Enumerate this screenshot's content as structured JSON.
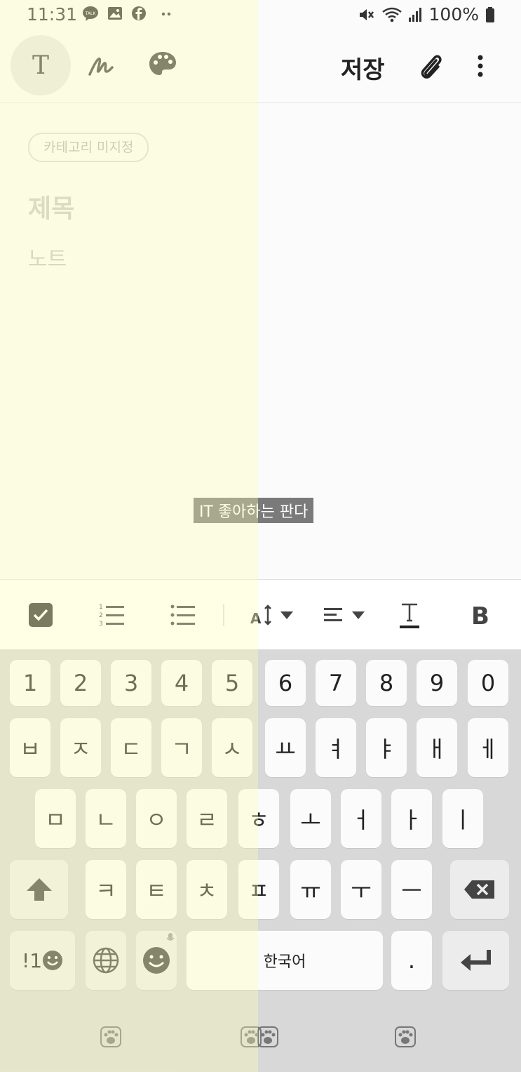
{
  "status": {
    "time": "11:31",
    "battery": "100%"
  },
  "toolbar": {
    "text_mode": "T",
    "save_label": "저장"
  },
  "note": {
    "category_chip": "카테고리 미지정",
    "title_placeholder": "제목",
    "body_placeholder": "노트"
  },
  "watermark": "IT 좋아하는 판다",
  "keyboard": {
    "row_numbers": [
      "1",
      "2",
      "3",
      "4",
      "5",
      "6",
      "7",
      "8",
      "9",
      "0"
    ],
    "row1": [
      "ㅂ",
      "ㅈ",
      "ㄷ",
      "ㄱ",
      "ㅅ",
      "ㅛ",
      "ㅕ",
      "ㅑ",
      "ㅐ",
      "ㅔ"
    ],
    "row2": [
      "ㅁ",
      "ㄴ",
      "ㅇ",
      "ㄹ",
      "ㅎ",
      "ㅗ",
      "ㅓ",
      "ㅏ",
      "ㅣ"
    ],
    "row3": [
      "ㅋ",
      "ㅌ",
      "ㅊ",
      "ㅍ",
      "ㅠ",
      "ㅜ",
      "ㅡ"
    ],
    "symbols_label": "!1",
    "space_label": "한국어",
    "period_label": "."
  }
}
